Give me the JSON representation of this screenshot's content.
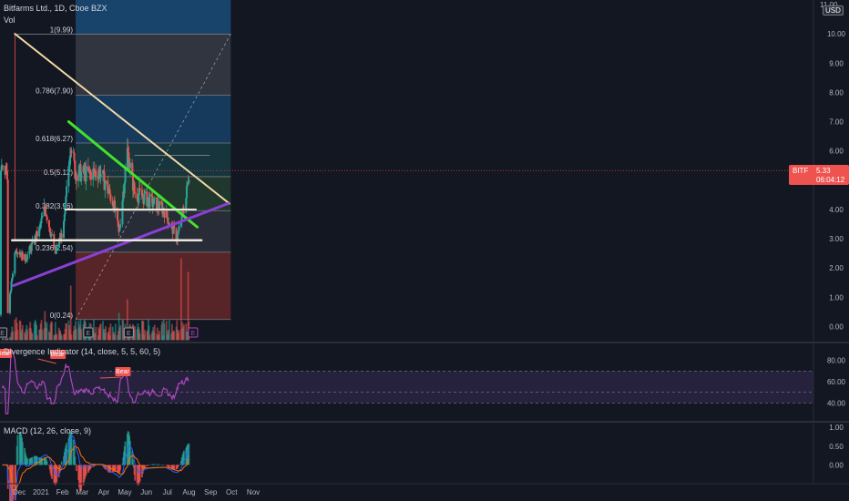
{
  "header": {
    "symbol_line": "Bitfarms Ltd., 1D, Cboe BZX",
    "vol_label": "Vol",
    "currency": "USD",
    "top_price": "11.00"
  },
  "price_marker": {
    "ticker": "BITF",
    "price": "5.33",
    "countdown": "06:04:12",
    "color": "#ef5350"
  },
  "panes": {
    "rsi_label": "Divergence Indicator (14, close, 5, 5, 60, 5)",
    "macd_label": "MACD (12, 26, close, 9)"
  },
  "colors": {
    "background": "#131722",
    "up": "#26a69a",
    "down": "#ef5350",
    "trend_upper": "#f3d9a6",
    "trend_green": "#44e02b",
    "trend_purple": "#8c3fd6",
    "rsi": "#ab47bc",
    "macd": "#2962ff",
    "signal": "#ff6d00",
    "bear": "#ef5350"
  },
  "chart_data": [
    {
      "type": "candlestick",
      "x_ticks": [
        "Dec",
        "2021",
        "Feb",
        "Mar",
        "Apr",
        "May",
        "Jun",
        "Jul",
        "Aug",
        "Sep",
        "Oct",
        "Nov"
      ],
      "y_ticks": [
        "0.00",
        "1.00",
        "2.00",
        "3.00",
        "4.00",
        "5.00",
        "6.00",
        "7.00",
        "8.00",
        "9.00",
        "10.00"
      ],
      "ylim": [
        0,
        11
      ],
      "last_close": 5.33,
      "fib_levels": [
        {
          "label": "1(9.99)",
          "value": 9.99
        },
        {
          "label": "0.786(7.90)",
          "value": 7.9
        },
        {
          "label": "0.618(6.27)",
          "value": 6.27
        },
        {
          "label": "0.5(5.12)",
          "value": 5.12
        },
        {
          "label": "0.382(3.96)",
          "value": 3.96
        },
        {
          "label": "0.236(2.54)",
          "value": 2.54
        },
        {
          "label": "0(0.24)",
          "value": 0.24
        }
      ],
      "event_markers": [
        "E",
        "E",
        "E",
        "E"
      ],
      "trendlines": [
        {
          "name": "upper-resistance",
          "from": [
            "2020-11-30",
            10.0
          ],
          "to": [
            "2021-10-03",
            4.2
          ]
        },
        {
          "name": "green-trend",
          "from": [
            "2021-02-15",
            7.0
          ],
          "to": [
            "2021-08-18",
            3.4
          ]
        },
        {
          "name": "purple-support",
          "from": [
            "2020-11-28",
            1.4
          ],
          "to": [
            "2021-10-01",
            4.2
          ]
        },
        {
          "name": "support-3.0",
          "from": [
            "2020-11-26",
            2.95
          ],
          "to": [
            "2021-08-24",
            2.95
          ]
        },
        {
          "name": "support-4.0",
          "from": [
            "2021-02-10",
            4.0
          ],
          "to": [
            "2021-08-16",
            4.0
          ]
        }
      ],
      "candles_sample": [
        {
          "date": "2020-11-20",
          "close": 0.45
        },
        {
          "date": "2020-12-01",
          "close": 2.7
        },
        {
          "date": "2020-12-15",
          "close": 2.3
        },
        {
          "date": "2021-01-04",
          "close": 3.3
        },
        {
          "date": "2021-01-12",
          "close": 4.1
        },
        {
          "date": "2021-01-27",
          "close": 2.5
        },
        {
          "date": "2021-02-08",
          "close": 3.4
        },
        {
          "date": "2021-02-18",
          "close": 6.4
        },
        {
          "date": "2021-02-24",
          "close": 5.3
        },
        {
          "date": "2021-03-10",
          "close": 5.2
        },
        {
          "date": "2021-04-01",
          "close": 5.3
        },
        {
          "date": "2021-04-20",
          "close": 4.2
        },
        {
          "date": "2021-04-28",
          "close": 3.2
        },
        {
          "date": "2021-05-10",
          "close": 6.0
        },
        {
          "date": "2021-05-20",
          "close": 4.6
        },
        {
          "date": "2021-06-10",
          "close": 4.3
        },
        {
          "date": "2021-07-01",
          "close": 4.0
        },
        {
          "date": "2021-07-20",
          "close": 3.0
        },
        {
          "date": "2021-08-02",
          "close": 4.4
        },
        {
          "date": "2021-08-06",
          "close": 5.33
        }
      ]
    },
    {
      "type": "line",
      "name": "Divergence Indicator",
      "y_ticks": [
        "40.00",
        "60.00",
        "80.00"
      ],
      "ylim": [
        25,
        95
      ],
      "band": [
        40,
        70
      ],
      "labels": [
        "Bear",
        "Bear",
        "Bear"
      ]
    },
    {
      "type": "bar",
      "name": "MACD",
      "y_ticks": [
        "0.00",
        "0.50",
        "1.00"
      ],
      "ylim": [
        -0.45,
        1.1
      ]
    }
  ]
}
